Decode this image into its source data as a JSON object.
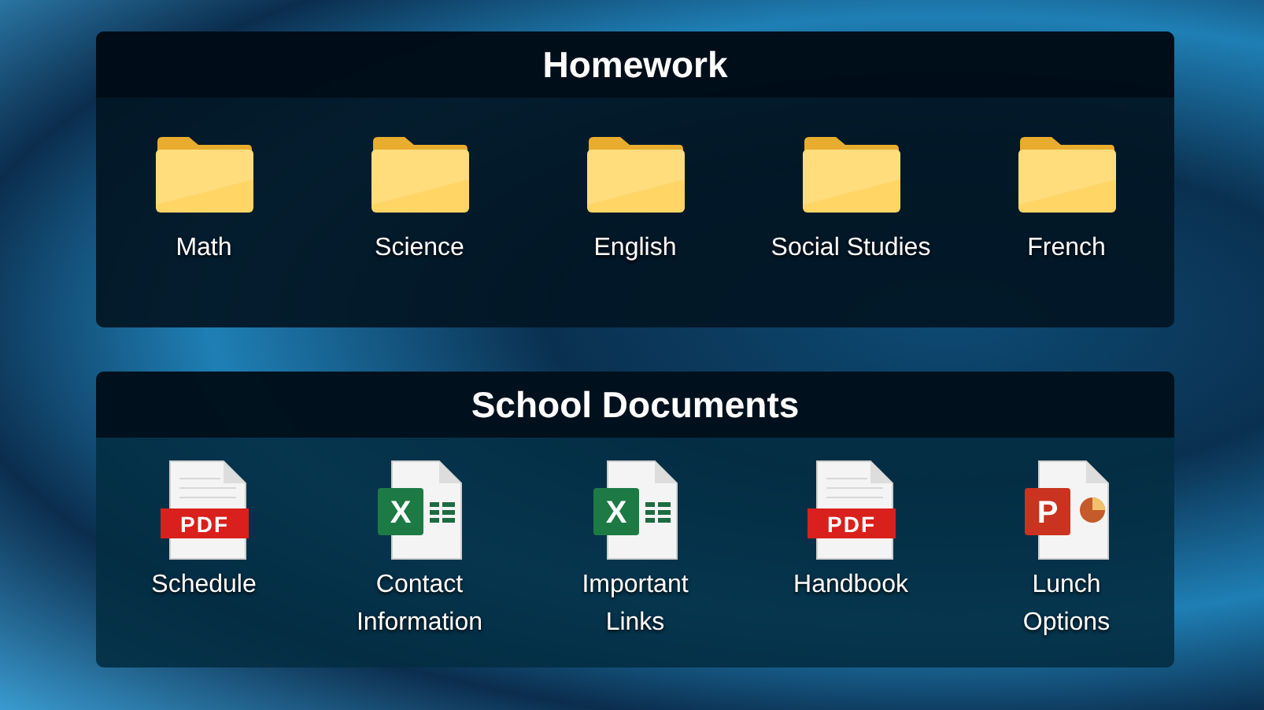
{
  "panels": [
    {
      "title": "Homework",
      "items": [
        {
          "kind": "folder",
          "label": "Math"
        },
        {
          "kind": "folder",
          "label": "Science"
        },
        {
          "kind": "folder",
          "label": "English"
        },
        {
          "kind": "folder",
          "label": "Social Studies"
        },
        {
          "kind": "folder",
          "label": "French"
        }
      ]
    },
    {
      "title": "School Documents",
      "items": [
        {
          "kind": "pdf",
          "badge": "PDF",
          "label": "Schedule"
        },
        {
          "kind": "spreadsheet",
          "badge": "X",
          "label": "Contact Information"
        },
        {
          "kind": "spreadsheet",
          "badge": "X",
          "label": "Important Links"
        },
        {
          "kind": "pdf",
          "badge": "PDF",
          "label": "Handbook"
        },
        {
          "kind": "presentation",
          "badge": "P",
          "label": "Lunch Options"
        }
      ]
    }
  ]
}
